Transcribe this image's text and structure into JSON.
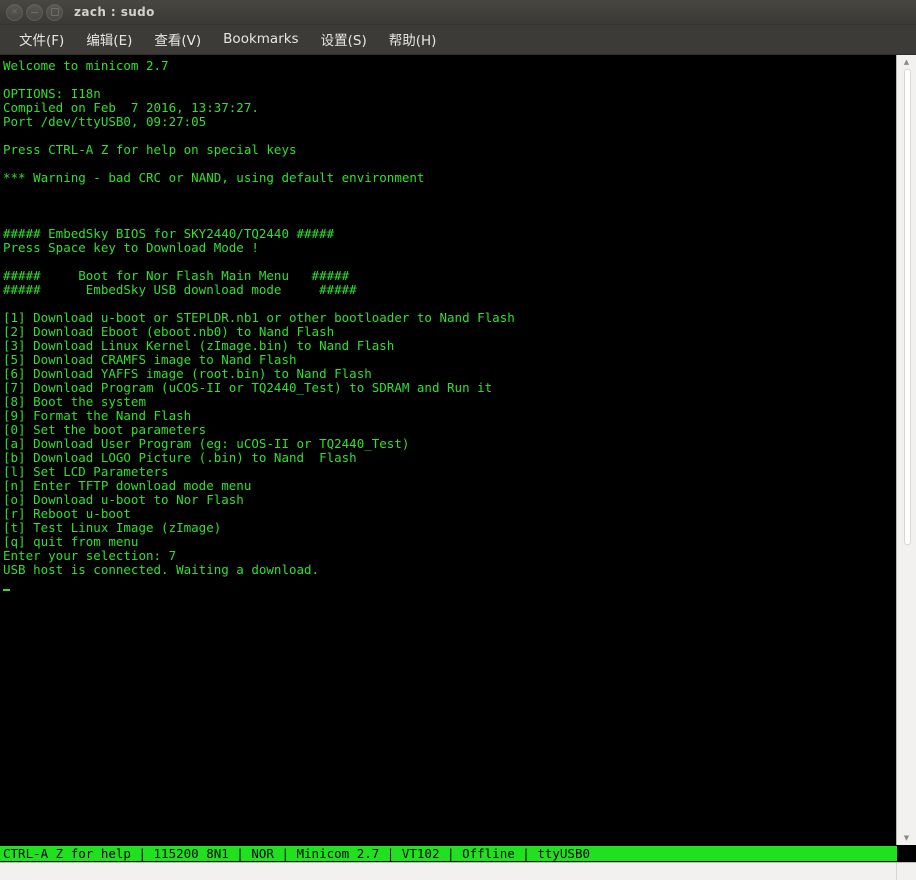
{
  "window": {
    "title": "zach : sudo",
    "controls": [
      {
        "name": "close-button",
        "glyph": "×"
      },
      {
        "name": "minimize-button",
        "glyph": "−"
      },
      {
        "name": "maximize-button",
        "glyph": "□"
      }
    ]
  },
  "menubar": {
    "items": [
      {
        "label": "文件(F)"
      },
      {
        "label": "编辑(E)"
      },
      {
        "label": "查看(V)"
      },
      {
        "label": "Bookmarks"
      },
      {
        "label": "设置(S)"
      },
      {
        "label": "帮助(H)"
      }
    ]
  },
  "terminal": {
    "foreground": "#2fe02f",
    "background": "#000000",
    "lines": [
      "Welcome to minicom 2.7",
      "",
      "OPTIONS: I18n",
      "Compiled on Feb  7 2016, 13:37:27.",
      "Port /dev/ttyUSB0, 09:27:05",
      "",
      "Press CTRL-A Z for help on special keys",
      "",
      "*** Warning - bad CRC or NAND, using default environment",
      "",
      "",
      "",
      "##### EmbedSky BIOS for SKY2440/TQ2440 #####",
      "Press Space key to Download Mode !",
      "",
      "#####     Boot for Nor Flash Main Menu   #####",
      "#####      EmbedSky USB download mode     #####",
      "",
      "[1] Download u-boot or STEPLDR.nb1 or other bootloader to Nand Flash",
      "[2] Download Eboot (eboot.nb0) to Nand Flash",
      "[3] Download Linux Kernel (zImage.bin) to Nand Flash",
      "[5] Download CRAMFS image to Nand Flash",
      "[6] Download YAFFS image (root.bin) to Nand Flash",
      "[7] Download Program (uCOS-II or TQ2440_Test) to SDRAM and Run it",
      "[8] Boot the system",
      "[9] Format the Nand Flash",
      "[0] Set the boot parameters",
      "[a] Download User Program (eg: uCOS-II or TQ2440_Test)",
      "[b] Download LOGO Picture (.bin) to Nand  Flash",
      "[l] Set LCD Parameters",
      "[n] Enter TFTP download mode menu",
      "[o] Download u-boot to Nor Flash",
      "[r] Reboot u-boot",
      "[t] Test Linux Image (zImage)",
      "[q] quit from menu",
      "Enter your selection: 7",
      "USB host is connected. Waiting a download."
    ],
    "cursor_line": "_"
  },
  "scrollbar": {
    "up_arrow": "▲",
    "down_arrow": "▼"
  },
  "statusbar": {
    "background": "#20e020",
    "foreground": "#000000",
    "text": "CTRL-A Z for help | 115200 8N1 | NOR | Minicom 2.7 | VT102 | Offline | ttyUSB0",
    "fields": [
      "CTRL-A Z for help",
      "115200 8N1",
      "NOR",
      "Minicom 2.7",
      "VT102",
      "Offline",
      "ttyUSB0"
    ]
  }
}
